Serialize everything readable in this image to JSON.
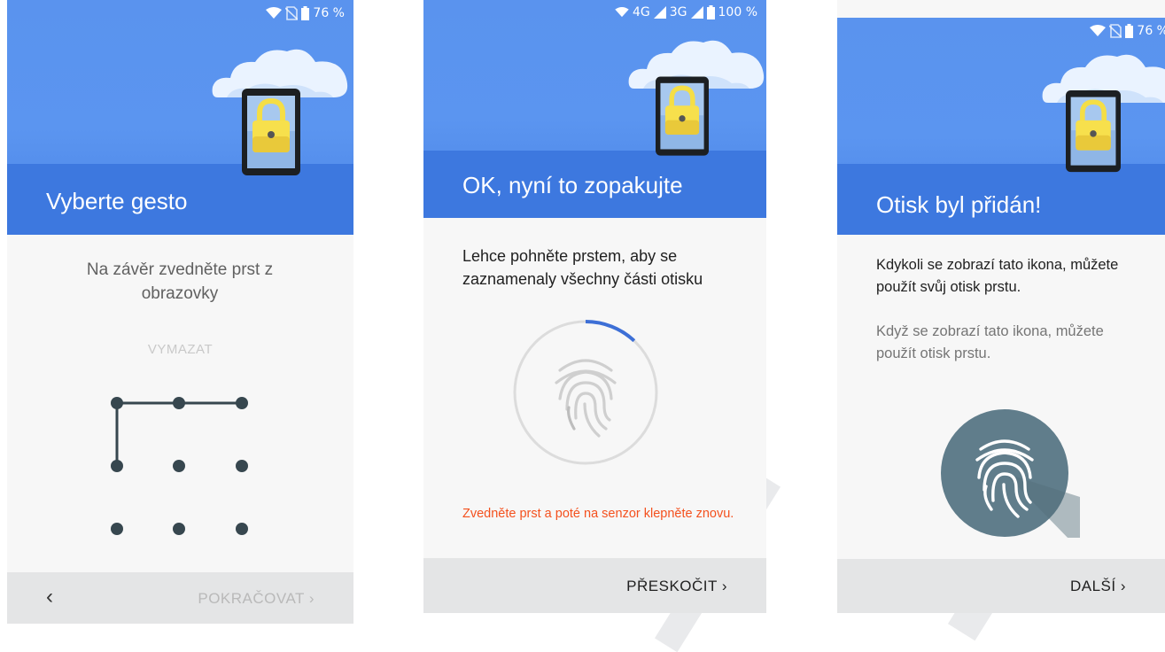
{
  "screens": [
    {
      "status": {
        "battery": "76 %"
      },
      "title": "Vyberte gesto",
      "instruction": "Na závěr zvedněte prst z obrazovky",
      "clear_label": "VYMAZAT",
      "back_symbol": "‹",
      "continue_label": "POKRAČOVAT ›"
    },
    {
      "status": {
        "net1": "4G",
        "net2": "3G",
        "battery": "100 %"
      },
      "title": "OK, nyní to zopakujte",
      "instruction": "Lehce pohněte prstem, aby se zaznamenaly všechny části otisku",
      "progress": 0.12,
      "error_text": "Zvedněte prst a poté na senzor klepněte znovu.",
      "skip_label": "PŘESKOČIT ›"
    },
    {
      "status": {
        "battery": "76 %"
      },
      "title": "Otisk byl přidán!",
      "primary_text": "Kdykoli se zobrazí tato ikona, můžete použít svůj otisk prstu.",
      "secondary_text": "Když se zobrazí tato ikona, můžete použít otisk prstu.",
      "next_label": "DALŠÍ ›"
    }
  ],
  "icons": [
    "wifi-icon",
    "no-sim-icon",
    "battery-icon",
    "signal-icon",
    "cloud-icon",
    "padlock-phone-icon",
    "fingerprint-icon"
  ],
  "colors": {
    "header": "#5b95f0",
    "header_band": "#3d78df",
    "progress": "#3d6fd6",
    "error": "#f4511e",
    "fingerprint_circle": "#607d8b",
    "pattern": "#37474f"
  }
}
